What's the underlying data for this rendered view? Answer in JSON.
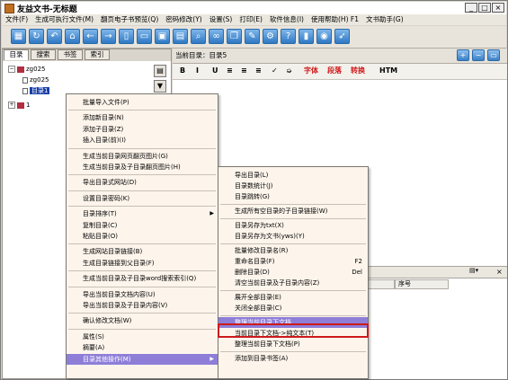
{
  "window": {
    "title": "友益文书-无标题",
    "minimize": "_",
    "maximize": "□",
    "close": "×"
  },
  "menubar": [
    "文件(F)",
    "生成可执行文件(M)",
    "翻页电子书预览(Q)",
    "密码修改(Y)",
    "设置(S)",
    "打印(E)",
    "软件信息(I)",
    "使用帮助(H) F1",
    "文书助手(G)"
  ],
  "toolbar": {
    "icons": [
      "grid-icon",
      "refresh-icon",
      "undo-icon",
      "home-icon",
      "back-icon",
      "forward-icon",
      "new-doc-icon",
      "open-folder-icon",
      "save-icon",
      "print-icon",
      "search-icon",
      "link-icon",
      "copy-icon",
      "edit-icon",
      "settings-icon",
      "help-icon",
      "book-icon",
      "globe-icon",
      "pointer-icon"
    ]
  },
  "left_panel": {
    "tabs": [
      "目录",
      "搜索",
      "书签",
      "索引"
    ],
    "active_tab": "目录",
    "tree": [
      {
        "toggle": "−",
        "label": "zg025"
      },
      {
        "toggle": "",
        "label": "zg025"
      },
      {
        "toggle": "",
        "label": "目录1"
      },
      {
        "toggle": "+",
        "label": "1"
      }
    ]
  },
  "right_panel": {
    "current_dir_label": "当前目录：目录5",
    "format_bar": [
      "B",
      "I",
      "U",
      "≡",
      "≡",
      "≡",
      "✓",
      "➭",
      "字体",
      "段落",
      "转换",
      "HTM"
    ],
    "grid_col_serial": "序号",
    "lower_close": "×"
  },
  "context_menu": {
    "items": [
      {
        "label": "批量导入文件(P)",
        "submenu": false
      },
      {
        "sep": true
      },
      {
        "label": "添加新目录(N)",
        "submenu": false
      },
      {
        "label": "添加子目录(Z)",
        "submenu": false
      },
      {
        "label": "插入目录(前)(I)",
        "submenu": false
      },
      {
        "sep": true
      },
      {
        "label": "生成当前目录网页翻页图片(G)",
        "submenu": false
      },
      {
        "label": "生成当前目录及子目录翻页图片(H)",
        "submenu": false
      },
      {
        "sep": true
      },
      {
        "label": "导出目录式网站(D)",
        "submenu": false
      },
      {
        "sep": true
      },
      {
        "label": "设置目录密码(K)",
        "submenu": false
      },
      {
        "sep": true
      },
      {
        "label": "目录排序(T)",
        "submenu": true
      },
      {
        "label": "复制目录(C)",
        "submenu": false
      },
      {
        "label": "粘贴目录(O)",
        "submenu": false
      },
      {
        "sep": true
      },
      {
        "label": "生成网站目录链接(B)",
        "submenu": false
      },
      {
        "label": "生成目录链接到父目录(F)",
        "submenu": false
      },
      {
        "sep": true
      },
      {
        "label": "生成当前目录及子目录word搜索索引(Q)",
        "submenu": false
      },
      {
        "sep": true
      },
      {
        "label": "导出当前目录文档内容(U)",
        "submenu": false
      },
      {
        "label": "导出当前目录及子目录内容(V)",
        "submenu": false
      },
      {
        "sep": true
      },
      {
        "label": "确认修改文档(W)",
        "submenu": false
      },
      {
        "sep": true
      },
      {
        "label": "属性(S)",
        "submenu": false
      },
      {
        "label": "摘要(A)",
        "submenu": false
      },
      {
        "label": "目录其他操作(M)",
        "submenu": true,
        "highlight": true
      }
    ]
  },
  "sub_menu": {
    "items": [
      {
        "label": "导出目录(L)"
      },
      {
        "label": "目录数统计(J)"
      },
      {
        "label": "目录跳转(G)"
      },
      {
        "sep": true
      },
      {
        "label": "生成所有空目录的子目录链接(W)"
      },
      {
        "sep": true
      },
      {
        "label": "目录另存为txt(X)"
      },
      {
        "label": "目录另存为文书(yws)(Y)"
      },
      {
        "sep": true
      },
      {
        "label": "批量修改目录名(R)"
      },
      {
        "label": "重命名目录(F)",
        "shortcut": "F2"
      },
      {
        "label": "删除目录(D)",
        "shortcut": "Del"
      },
      {
        "label": "清空当前目录及子目录内容(Z)"
      },
      {
        "sep": true
      },
      {
        "label": "展开全部目录(E)"
      },
      {
        "label": "关闭全部目录(C)"
      },
      {
        "sep": true
      },
      {
        "label": "整理当前目录下文档",
        "highlight": true
      },
      {
        "label": "当前目录下文档->纯文本(T)"
      },
      {
        "label": "整理当前目录下文档(P)"
      },
      {
        "sep": true
      },
      {
        "label": "添加到目录书签(A)"
      }
    ]
  },
  "colors": {
    "highlight": "#8e7ed8",
    "menu_bg": "#fdf5ec",
    "accent_red": "#cc1a1a",
    "toolbar_blue": "#2f78c4"
  }
}
